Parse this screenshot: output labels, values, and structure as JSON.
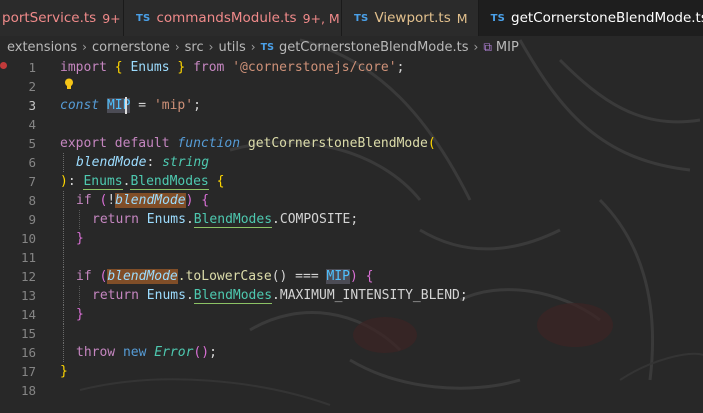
{
  "tabs": [
    {
      "icon": "TS",
      "name": "portService.ts",
      "mark": "9+",
      "state": "error"
    },
    {
      "icon": "TS",
      "name": "commandsModule.ts",
      "mark": "9+, M",
      "state": "error"
    },
    {
      "icon": "TS",
      "name": "Viewport.ts",
      "mark": "M",
      "state": "modified"
    },
    {
      "icon": "TS",
      "name": "getCornerstoneBlendMode.ts",
      "mark": "",
      "state": "active",
      "close": "×"
    }
  ],
  "breadcrumb": {
    "parts": [
      "extensions",
      "cornerstone",
      "src",
      "utils"
    ],
    "file_icon": "TS",
    "file": "getCornerstoneBlendMode.ts",
    "symbol": "MIP",
    "symbol_icon": "cube-icon"
  },
  "editor": {
    "line_numbers": [
      "1",
      "2",
      "3",
      "4",
      "5",
      "6",
      "7",
      "8",
      "9",
      "10",
      "11",
      "12",
      "13",
      "14",
      "15",
      "16",
      "17",
      "18"
    ],
    "current_line": "3",
    "lightbulb_line": "2",
    "breakpoint_line": "1",
    "tokens": {
      "l1": [
        "import",
        "{",
        "Enums",
        "}",
        "from",
        "'@cornerstonejs/core'",
        ";"
      ],
      "l3": [
        "const",
        "MIP",
        "=",
        "'mip'",
        ";"
      ],
      "l5": [
        "export",
        "default",
        "function",
        "getCornerstoneBlendMode",
        "("
      ],
      "l6": [
        "blendMode",
        ":",
        "string"
      ],
      "l7": [
        ")",
        ":",
        "Enums",
        ".",
        "BlendModes",
        "{"
      ],
      "l8": [
        "if",
        "(",
        "!",
        "blendMode",
        ")",
        "{"
      ],
      "l9": [
        "return",
        "Enums",
        ".",
        "BlendModes",
        ".COMPOSITE;"
      ],
      "l10": [
        "}"
      ],
      "l12": [
        "if",
        "(",
        "blendMode",
        ".toLowerCase",
        "()",
        "===",
        "MIP",
        ")",
        "{"
      ],
      "l13": [
        "return",
        "Enums",
        ".",
        "BlendModes",
        ".MAXIMUM_INTENSITY_BLEND;"
      ],
      "l14": [
        "}"
      ],
      "l16": [
        "throw",
        "new",
        "Error",
        "()",
        ";"
      ],
      "l17": [
        "}"
      ]
    }
  },
  "colors": {
    "keyword_control": "#c586c0",
    "keyword_storage": "#569cd6",
    "function": "#dcdcaa",
    "string": "#ce9178",
    "type": "#4ec9b0",
    "variable": "#9cdcfe",
    "constant": "#4fc1ff",
    "tab_error": "#f08a8a",
    "tab_modified": "#e2c08d"
  }
}
